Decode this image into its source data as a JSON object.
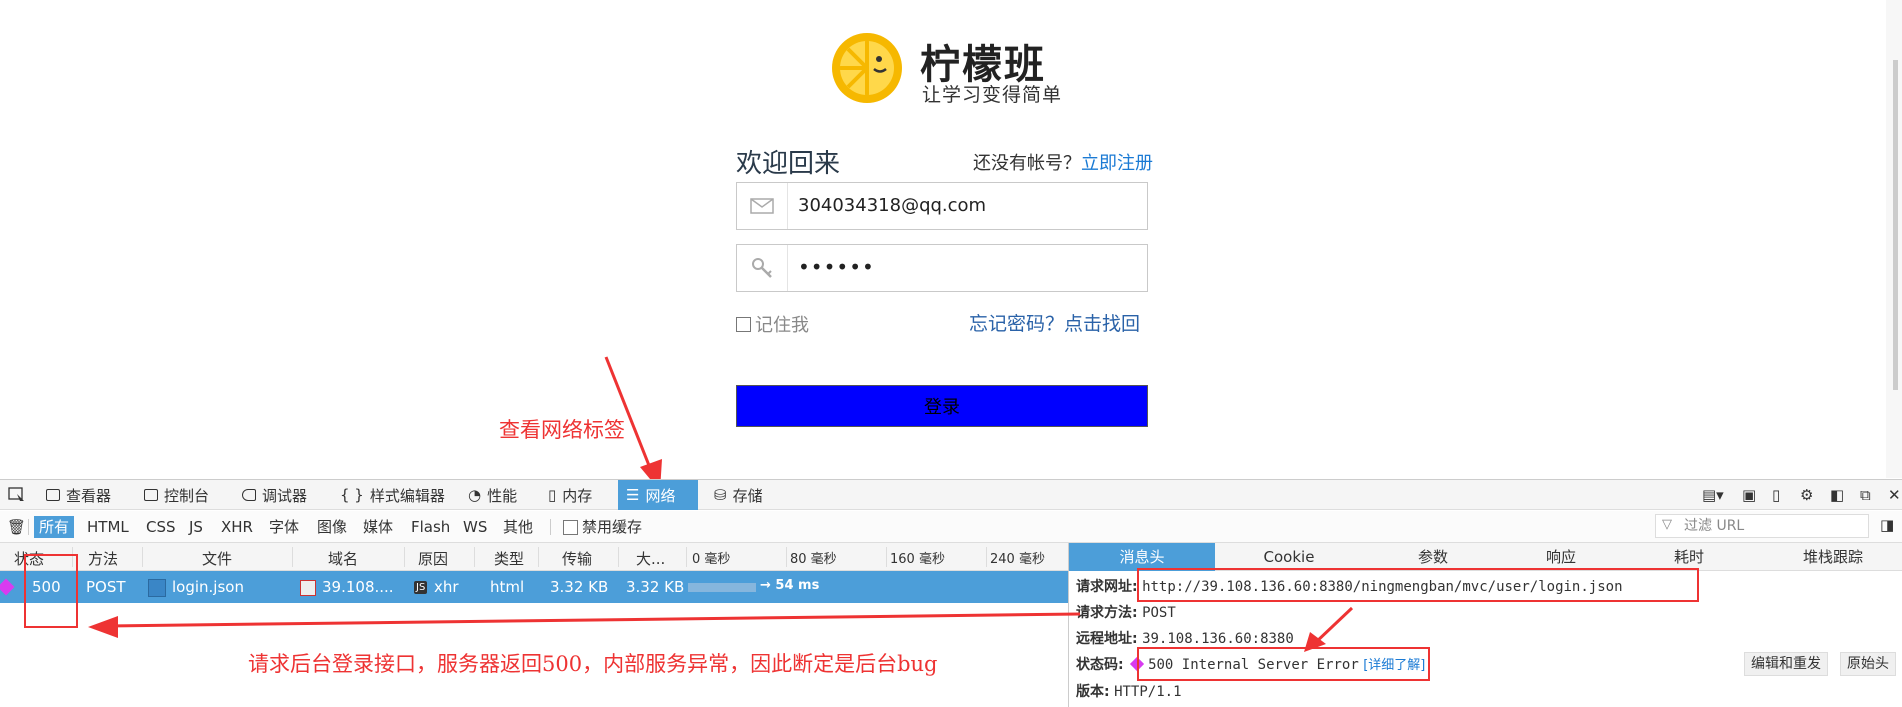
{
  "brand": {
    "title": "柠檬班",
    "subtitle": "让学习变得简单"
  },
  "login": {
    "welcome": "欢迎回来",
    "no_account": "还没有帐号？",
    "register_link": "立即注册",
    "email_value": "304034318@qq.com",
    "password_value": "••••••",
    "remember_label": "记住我",
    "forgot_link": "忘记密码？点击找回",
    "submit_label": "登录"
  },
  "annotations": {
    "network_tab_note": "查看网络标签",
    "bug_note": "请求后台登录接口，服务器返回500，内部服务异常，因此断定是后台bug"
  },
  "devtools": {
    "tabs": [
      "查看器",
      "控制台",
      "调试器",
      "样式编辑器",
      "性能",
      "内存",
      "网络",
      "存储"
    ],
    "active_tab": "网络",
    "filters": [
      "所有",
      "HTML",
      "CSS",
      "JS",
      "XHR",
      "字体",
      "图像",
      "媒体",
      "Flash",
      "WS",
      "其他"
    ],
    "disable_cache_label": "禁用缓存",
    "filter_url_placeholder": "过滤 URL",
    "columns": [
      "状态",
      "方法",
      "文件",
      "域名",
      "原因",
      "类型",
      "传输",
      "大...",
      "0 毫秒",
      "80 毫秒",
      "160 毫秒",
      "240 毫秒"
    ],
    "request": {
      "status": "500",
      "method": "POST",
      "file": "login.json",
      "domain": "39.108....",
      "cause": "xhr",
      "type": "html",
      "transferred": "3.32 KB",
      "size": "3.32 KB",
      "timing": "→ 54 ms"
    },
    "detail_tabs": [
      "消息头",
      "Cookie",
      "参数",
      "响应",
      "耗时",
      "堆栈跟踪"
    ],
    "detail": {
      "url_label": "请求网址:",
      "url_value": "http://39.108.136.60:8380/ningmengban/mvc/user/login.json",
      "method_label": "请求方法:",
      "method_value": "POST",
      "remote_label": "远程地址:",
      "remote_value": "39.108.136.60:8380",
      "status_label": "状态码:",
      "status_value": "500 Internal Server Error",
      "learn_more": "[详细了解]",
      "version_label": "版本:",
      "version_value": "HTTP/1.1",
      "edit_resend": "编辑和重发",
      "raw_headers": "原始头"
    }
  },
  "colors": {
    "accent": "#4c9ed9",
    "annotation": "#e33333",
    "submit_bg": "#0000ff"
  }
}
